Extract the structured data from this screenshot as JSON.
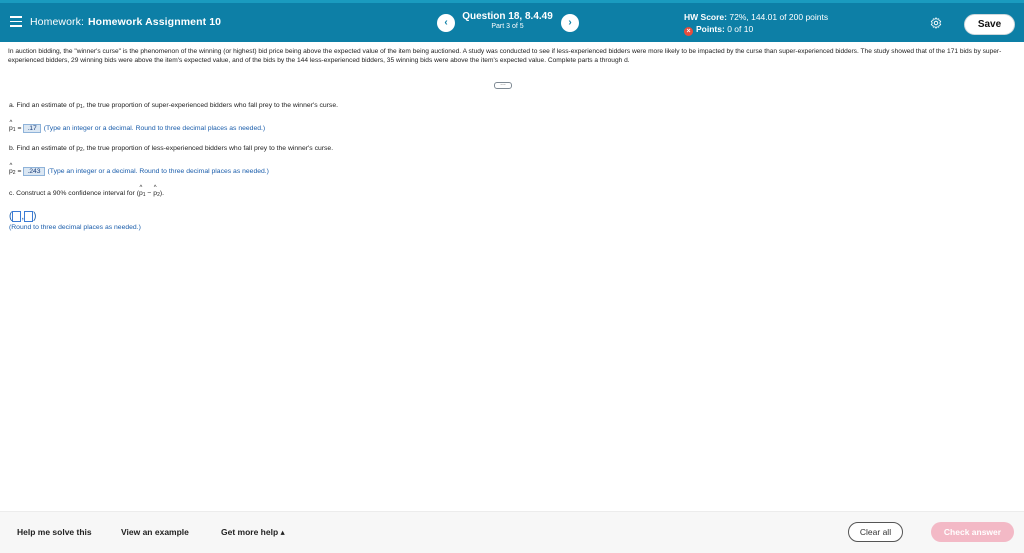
{
  "header": {
    "homework_label": "Homework:",
    "assignment_name": "Homework Assignment 10",
    "prev_icon": "chevron-left-icon",
    "next_icon": "chevron-right-icon",
    "question_label": "Question 18, 8.4.49",
    "part_label": "Part 3 of 5",
    "score_label": "HW Score:",
    "score_value": "72%, 144.01 of 200 points",
    "points_label": "Points:",
    "points_value": "0 of 10",
    "save_label": "Save",
    "accent_color": "#0d7fa6"
  },
  "problem": {
    "intro": "In auction bidding, the \"winner's curse\" is the phenomenon of the winning (or highest) bid price being above the expected value of the item being auctioned. A study was conducted to see if less-experienced bidders were more likely to be impacted by the curse than super-experienced bidders. The study showed that of the 171 bids by super-experienced bidders, 29 winning bids were above the item's expected value, and of the bids by the 144 less-experienced bidders, 35 winning bids were above the item's expected value. Complete parts a through d.",
    "more_label": "…",
    "part_a_text1": "a. Find an estimate of p",
    "part_a_sub": "1",
    "part_a_text2": ", the true proportion of super-experienced bidders who fall prey to the winner's curse.",
    "answer1_label": "p",
    "answer1_sub": "1",
    "answer1_eq": " = ",
    "answer1_value": ".17",
    "answer1_hint": "(Type an integer or a decimal. Round to three decimal places as needed.)",
    "part_b_text1": "b. Find an estimate of p",
    "part_b_sub": "2",
    "part_b_text2": ", the true proportion of less-experienced bidders who fall prey to the winner's curse.",
    "answer2_label": "p",
    "answer2_sub": "2",
    "answer2_eq": " = ",
    "answer2_value": ".243",
    "answer2_hint": "(Type an integer or a decimal. Round to three decimal places as needed.)",
    "part_c_text": "c. Construct a 90% confidence interval for (",
    "part_c_p1": "p",
    "part_c_sub1": "1",
    "part_c_minus": " − ",
    "part_c_p2": "p",
    "part_c_sub2": "2",
    "part_c_end": ").",
    "interval_open": "(",
    "interval_comma": ",",
    "interval_close": ")",
    "round_note": "(Round to three decimal places as needed.)"
  },
  "footer": {
    "help_label": "Help me solve this",
    "example_label": "View an example",
    "more_help_label": "Get more help ▴",
    "clear_label": "Clear all",
    "check_label": "Check answer"
  }
}
